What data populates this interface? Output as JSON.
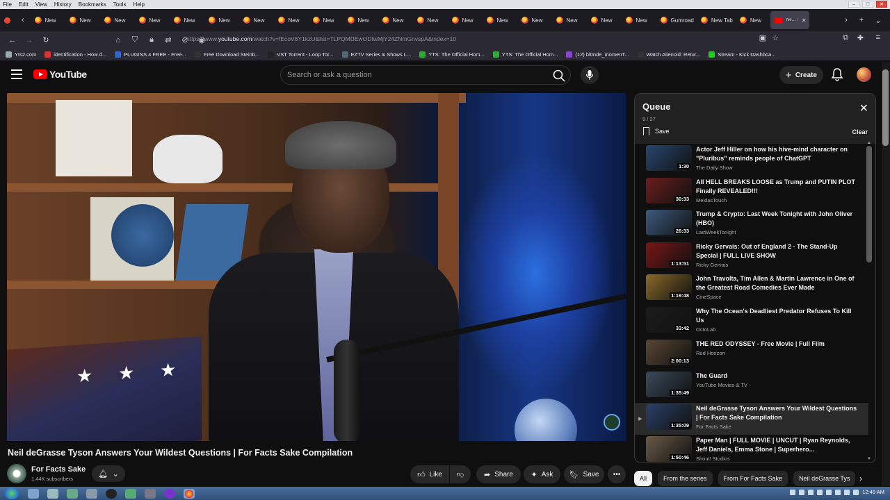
{
  "os_menu": [
    "File",
    "Edit",
    "View",
    "History",
    "Bookmarks",
    "Tools",
    "Help"
  ],
  "tabs": {
    "items": [
      "New",
      "New",
      "New",
      "New",
      "New",
      "New",
      "New",
      "New",
      "New",
      "New",
      "New",
      "New",
      "New",
      "New",
      "New",
      "New",
      "New",
      "New",
      "Gumroad",
      "New Tab",
      "New"
    ],
    "active_label": "Ne… Pl…"
  },
  "navbar": {
    "url_prefix": "https://www.",
    "url_host": "youtube.com",
    "url_rest": "/watch?v=fEcoV6Y1kzU&list=TLPQMDEwODIwMjY24ZNmGnvspA&index=10"
  },
  "bookmarks": [
    {
      "label": "Yts2.com",
      "color": "#9aa"
    },
    {
      "label": "identification - How d...",
      "color": "#d33"
    },
    {
      "label": "PLUGINS 4 FREE - Free...",
      "color": "#36c"
    },
    {
      "label": "Free Download Steinb...",
      "color": "#333"
    },
    {
      "label": "VST Torrent - Loop Tor...",
      "color": "#222"
    },
    {
      "label": "EZTV Series & Shows L...",
      "color": "#567"
    },
    {
      "label": "YTS: The Official Hom...",
      "color": "#3a3"
    },
    {
      "label": "YTS: The Official Hom...",
      "color": "#3a3"
    },
    {
      "label": "(12) bl0nde_momenT...",
      "color": "#84c"
    },
    {
      "label": "Watch Alienoid: Retur...",
      "color": "#333"
    },
    {
      "label": "Stream - Kick Dashboa...",
      "color": "#2c2"
    }
  ],
  "youtube": {
    "logo": "YouTube",
    "search_placeholder": "Search or ask a question",
    "create_label": "Create"
  },
  "video": {
    "title": "Neil deGrasse Tyson Answers Your Wildest Questions | For Facts Sake Compilation",
    "channel": "For Facts Sake",
    "subscribers": "1.44K subscribers",
    "actions": {
      "like": "Like",
      "share": "Share",
      "ask": "Ask",
      "save": "Save"
    }
  },
  "queue": {
    "title": "Queue",
    "count": "9 / 27",
    "save_label": "Save",
    "clear_label": "Clear",
    "items": [
      {
        "title": "Actor Jeff Hiller on how his hive-mind character on \"Pluribus\" reminds people of ChatGPT",
        "channel": "The Daily Show",
        "duration": "1:30",
        "thumb": "#27466e"
      },
      {
        "title": "All HELL BREAKS LOOSE as Trump and PUTIN PLOT Finally REVEALED!!!",
        "channel": "MeidasTouch",
        "duration": "30:33",
        "thumb": "#6b1d1d"
      },
      {
        "title": "Trump & Crypto: Last Week Tonight with John Oliver (HBO)",
        "channel": "LastWeekTonight",
        "duration": "26:33",
        "thumb": "#3d5a7e"
      },
      {
        "title": "Ricky Gervais: Out of England 2 - The Stand-Up Special | FULL LIVE SHOW",
        "channel": "Ricky Gervais",
        "duration": "1:13:51",
        "thumb": "#7a1515"
      },
      {
        "title": "John Travolta, Tim Allen & Martin Lawrence in One of the Greatest Road Comedies Ever Made",
        "channel": "CineSpace",
        "duration": "1:19:48",
        "thumb": "#8a6a2a"
      },
      {
        "title": "Why The Ocean's Deadliest Predator Refuses To Kill Us",
        "channel": "OctoLab",
        "duration": "33:42",
        "thumb": "#1c1c1c"
      },
      {
        "title": "THE RED ODYSSEY - Free Movie | Full Film",
        "channel": "Red Horizon",
        "duration": "2:00:13",
        "thumb": "#5a4634"
      },
      {
        "title": "The Guard",
        "channel": "YouTube Movies & TV",
        "duration": "1:35:49",
        "thumb": "#3a4a5a"
      },
      {
        "title": "Neil deGrasse Tyson Answers Your Wildest Questions | For Facts Sake Compilation",
        "channel": "For Facts Sake",
        "duration": "1:35:09",
        "thumb": "#2a3f66",
        "active": true
      },
      {
        "title": "Paper Man | FULL MOVIE | UNCUT | Ryan Reynolds, Jeff Daniels, Emma Stone | Superhero...",
        "channel": "Shout! Studios",
        "duration": "1:50:46",
        "thumb": "#6a5a48"
      }
    ]
  },
  "chips": [
    "All",
    "From the series",
    "From For Facts Sake",
    "Neil deGrasse Tys"
  ],
  "taskbar": {
    "clock": "12:49 AM"
  }
}
